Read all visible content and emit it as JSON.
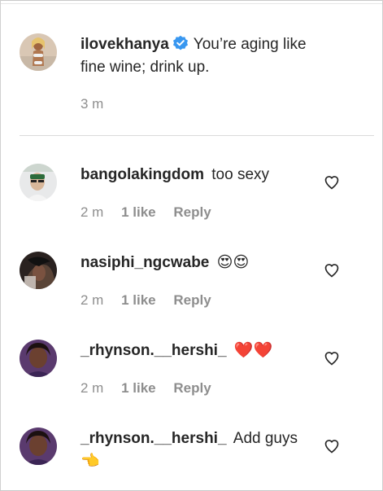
{
  "caption": {
    "username": "ilovekhanya",
    "text": "You’re aging like fine wine; drink up.",
    "time": "3 m",
    "verified": true
  },
  "comments": [
    {
      "username": "bangolakingdom",
      "text": "too sexy",
      "time": "2 m",
      "likes": "1 like",
      "reply": "Reply"
    },
    {
      "username": "nasiphi_ngcwabe",
      "text": "😍😍",
      "time": "2 m",
      "likes": "1 like",
      "reply": "Reply"
    },
    {
      "username": "_rhynson.__hershi_",
      "text": "❤️❤️",
      "time": "2 m",
      "likes": "1 like",
      "reply": "Reply"
    },
    {
      "username": "_rhynson.__hershi_",
      "text": "Add guys 👈"
    }
  ],
  "icons": {
    "like": "heart-outline-icon",
    "verified": "verified-badge-icon"
  },
  "colors": {
    "verified": "#3897f0",
    "username": "#262626",
    "meta": "#8e8e8e",
    "divider": "#dbdbdb"
  }
}
